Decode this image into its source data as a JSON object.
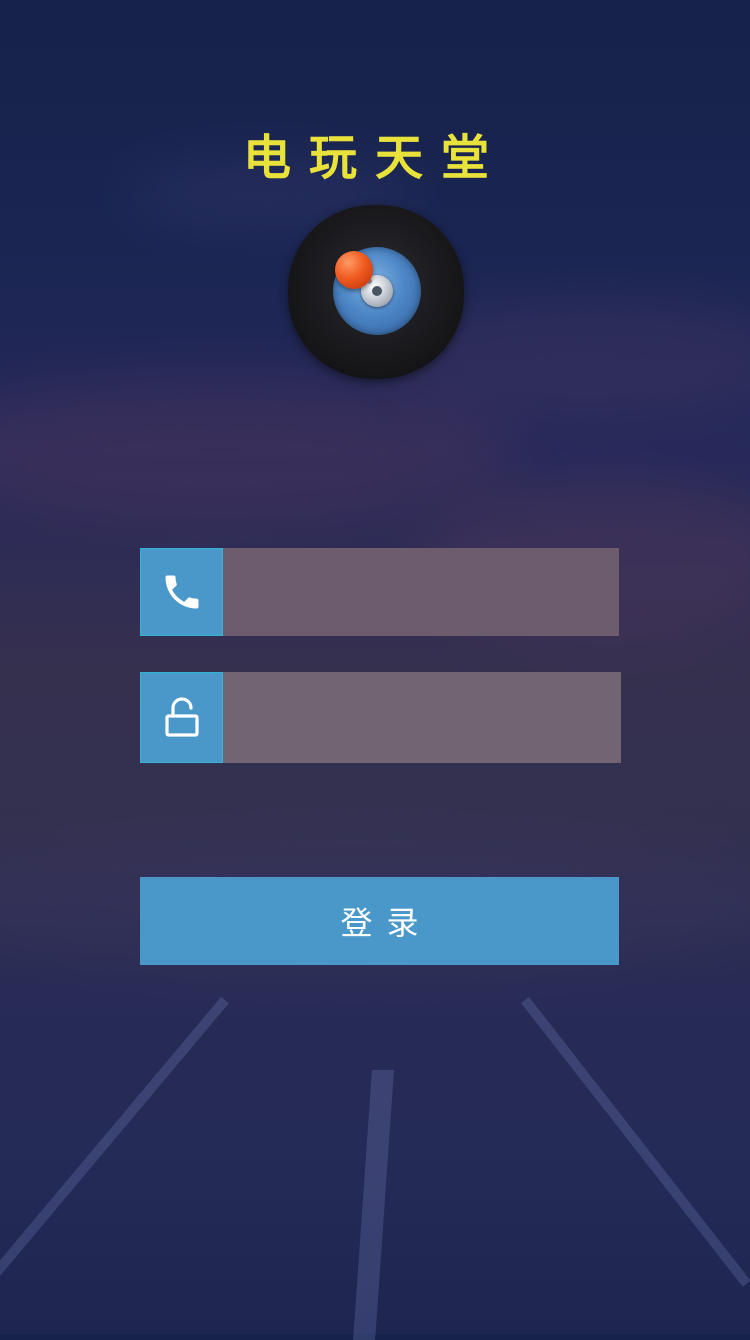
{
  "app": {
    "title": "电玩天堂"
  },
  "login_form": {
    "phone_input": {
      "value": "",
      "placeholder": "",
      "icon": "phone-icon"
    },
    "password_input": {
      "value": "",
      "placeholder": "",
      "icon": "unlock-icon"
    },
    "submit_label": "登录"
  },
  "colors": {
    "title": "#e8e23a",
    "accent": "#4a98c9",
    "input_background": "#6c5c6e",
    "icon_border": "#35b5d8"
  }
}
